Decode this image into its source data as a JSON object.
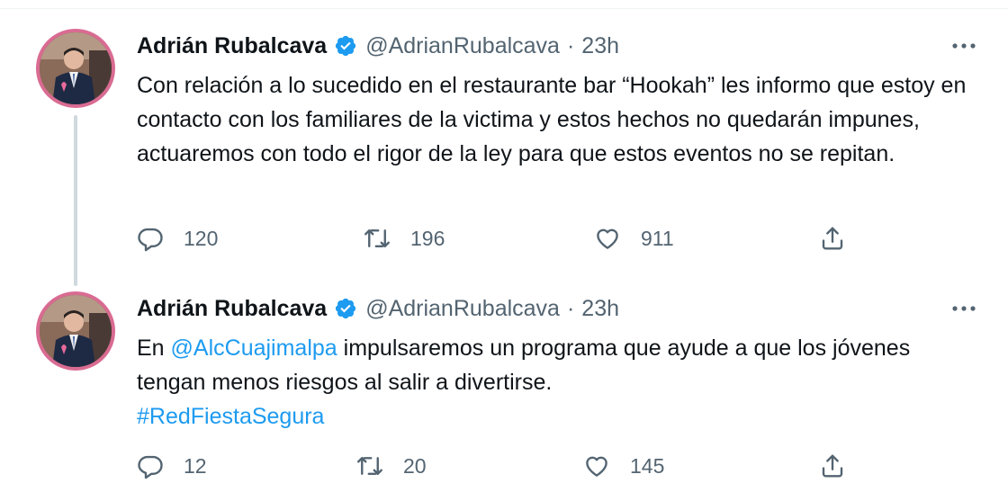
{
  "tweets": [
    {
      "author_name": "Adrián Rubalcava",
      "handle": "@AdrianRubalcava",
      "separator": "·",
      "time": "23h",
      "text": "Con relación a lo sucedido en el restaurante bar “Hookah” les informo que estoy en contacto con los familiares de la victima y estos hechos no quedarán impunes, actuaremos con todo el rigor de la ley para que estos eventos no se repitan.",
      "replies": "120",
      "retweets": "196",
      "likes": "911"
    },
    {
      "author_name": "Adrián Rubalcava",
      "handle": "@AdrianRubalcava",
      "separator": "·",
      "time": "23h",
      "text_prefix": "En ",
      "mention": "@AlcCuajimalpa",
      "text_middle": " impulsaremos un programa que ayude a que los jóvenes tengan menos riesgos al salir a divertirse.",
      "hashtag": "#RedFiestaSegura",
      "replies": "12",
      "retweets": "20",
      "likes": "145"
    }
  ],
  "colors": {
    "link": "#1d9bf0",
    "secondary_text": "#536471",
    "verified_badge": "#1d9bf0",
    "avatar_ring": "#d96b92"
  },
  "icons": [
    "verified-badge-icon",
    "more-options-icon",
    "reply-icon",
    "retweet-icon",
    "like-icon",
    "share-icon"
  ]
}
